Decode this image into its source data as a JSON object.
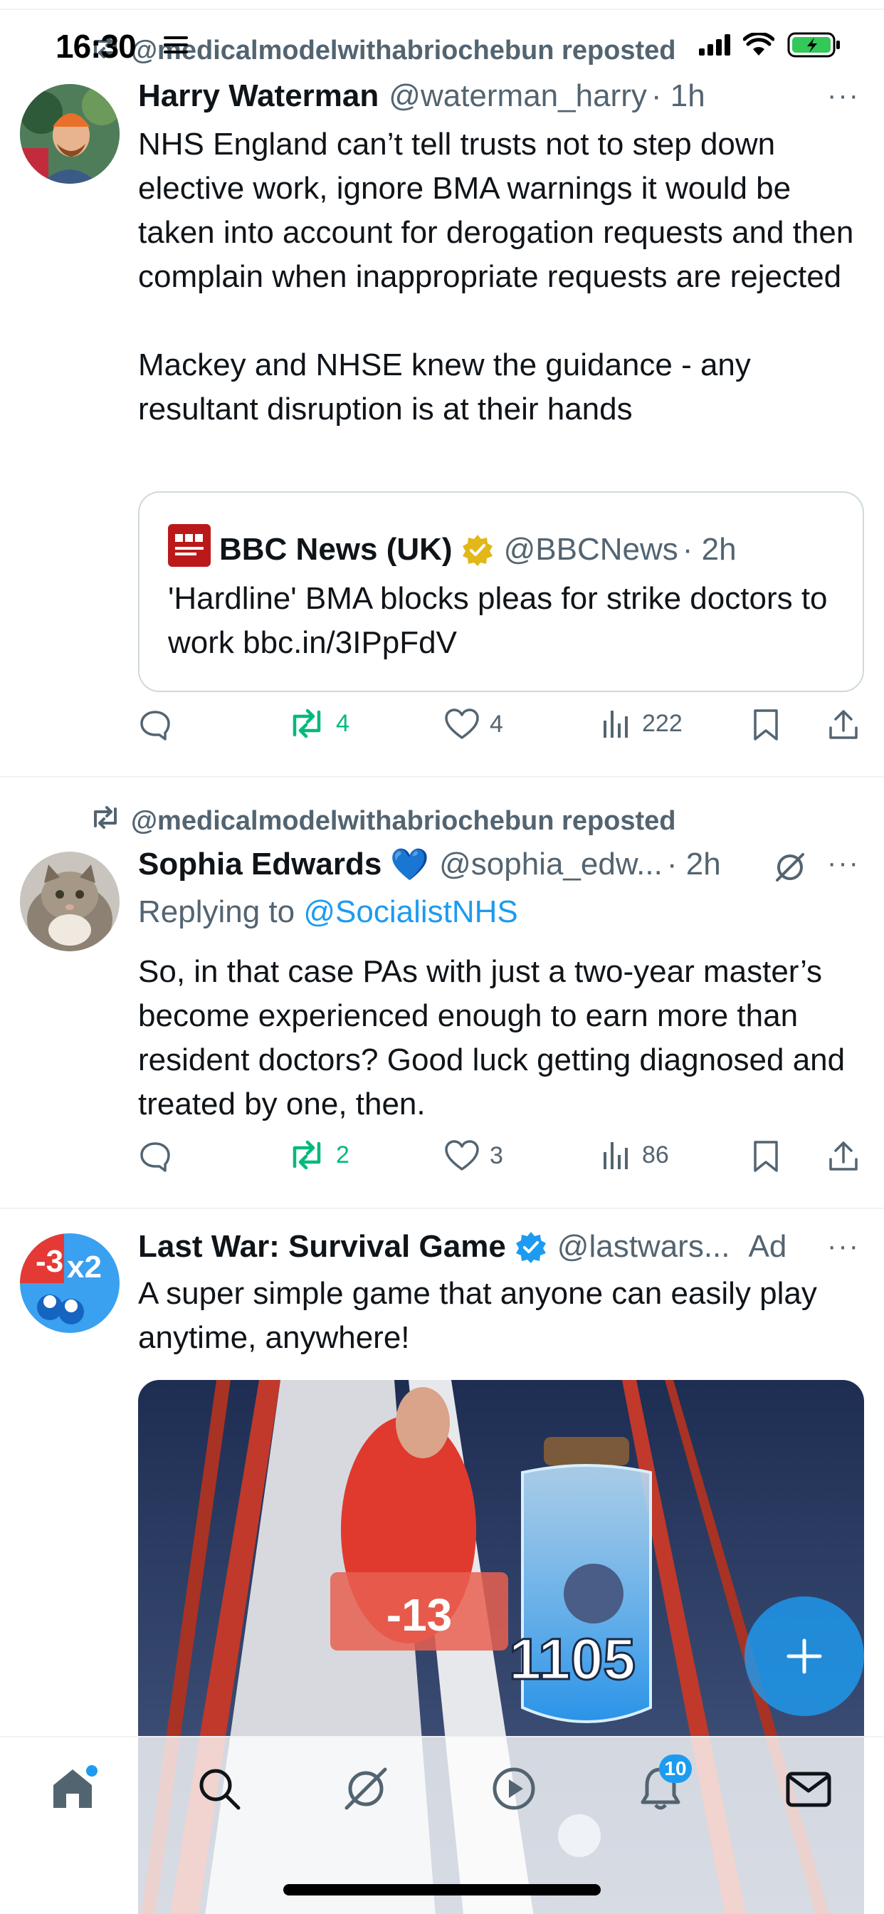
{
  "status_bar": {
    "time": "16:30"
  },
  "posts": [
    {
      "repost_label": "@medicalmodelwithabriochebun reposted",
      "name": "Harry Waterman",
      "handle": "@waterman_harry",
      "time": "· 1h",
      "text": "NHS England can’t tell trusts not to step down elective work, ignore BMA warnings it would be taken into account for derogation requests and then complain when inappropriate requests are rejected\n\nMackey and NHSE knew the guidance - any resultant disruption is at their hands",
      "quote": {
        "name": "BBC News (UK)",
        "handle": "@BBCNews",
        "time": "· 2h",
        "text": "'Hardline' BMA blocks pleas for strike doctors to work bbc.in/3IPpFdV"
      },
      "stats": {
        "replies": "",
        "reposts": "4",
        "likes": "4",
        "views": "222"
      }
    },
    {
      "repost_label": "@medicalmodelwithabriochebun reposted",
      "name": "Sophia Edwards",
      "name_emoji": "💙",
      "handle": "@sophia_edw...",
      "time": "· 2h",
      "replying_prefix": "Replying to",
      "replying_to": "@SocialistNHS",
      "text": "So, in that case PAs with just a two-year master’s become experienced enough to earn more than resident doctors? Good luck getting diagnosed and treated by one, then.",
      "stats": {
        "replies": "",
        "reposts": "2",
        "likes": "3",
        "views": "86"
      }
    },
    {
      "name": "Last War: Survival Game",
      "handle": "@lastwars...",
      "ad_label": "Ad",
      "text": "A super simple game that anyone can easily play anytime, anywhere!",
      "media": {
        "gate_value": "-13",
        "bottle_value": "1105",
        "avatar_badge_left": "-3",
        "avatar_badge_right": "x2"
      }
    }
  ],
  "tab_bar": {
    "notifications_badge": "10",
    "tabs": [
      "home-icon",
      "search-icon",
      "grok-icon",
      "video-icon",
      "notifications-icon",
      "messages-icon"
    ]
  },
  "colors": {
    "accent": "#1d9bf0",
    "repost_green": "#00ba7c",
    "secondary_text": "#536471",
    "verified_gold": "#e2b719"
  }
}
